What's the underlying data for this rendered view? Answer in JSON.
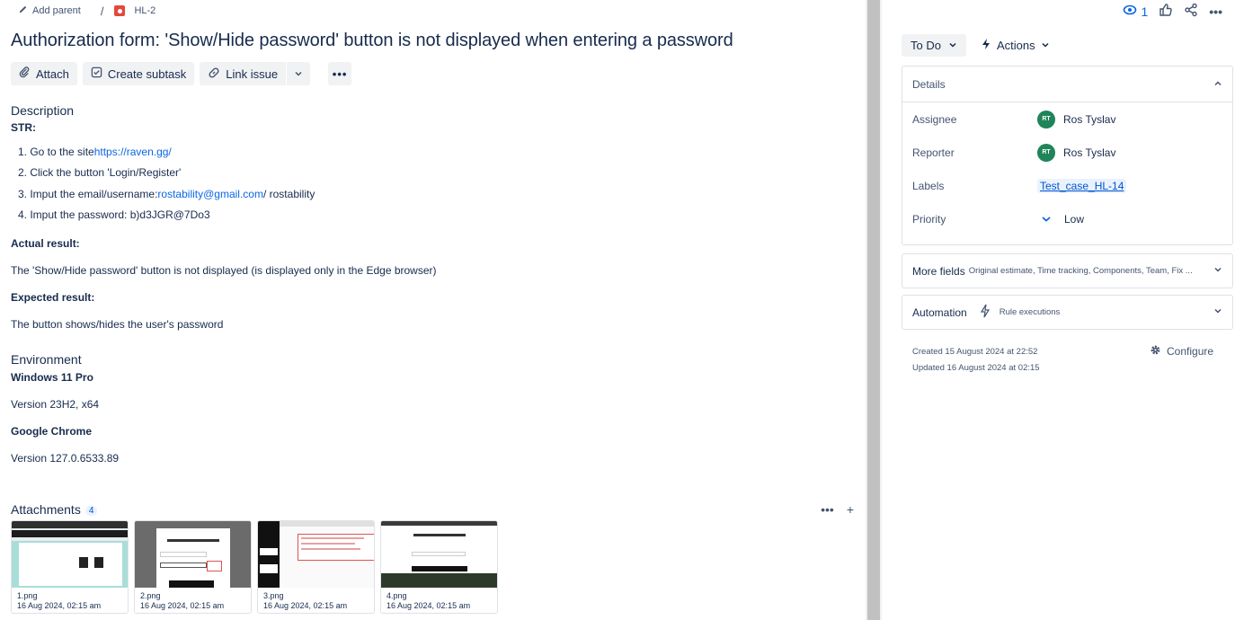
{
  "breadcrumb": {
    "add_parent": "Add parent",
    "separator": "/",
    "issue_key": "HL-2"
  },
  "issue": {
    "title": "Authorization form: 'Show/Hide password' button is not displayed when entering a password"
  },
  "toolbar": {
    "attach": "Attach",
    "create_subtask": "Create subtask",
    "link_issue": "Link issue",
    "more": "•••"
  },
  "description": {
    "heading": "Description",
    "str_label": "STR:",
    "steps": [
      {
        "text": "1. Go to the site ",
        "link": "https://raven.gg/",
        "after": ""
      },
      {
        "text": "2. Click the button 'Login/Register'",
        "link": "",
        "after": ""
      },
      {
        "text": "3. Imput the email/username: ",
        "link": "rostability@gmail.com",
        "after": " / rostability"
      },
      {
        "text": "4. Imput the password: b)d3JGR@7Do3",
        "link": "",
        "after": ""
      }
    ],
    "actual_label": "Actual result:",
    "actual_text": "The 'Show/Hide password' button is not displayed (is displayed only in the Edge browser)",
    "expected_label": "Expected result:",
    "expected_text": "The button shows/hides the user's password"
  },
  "environment": {
    "heading": "Environment",
    "os": "Windows 11 Pro",
    "os_version": "Version 23H2, x64",
    "browser": "Google Chrome",
    "browser_version": "Version 127.0.6533.89"
  },
  "attachments": {
    "heading": "Attachments",
    "count": "4",
    "items": [
      {
        "name": "1.png",
        "date": "16 Aug 2024, 02:15 am"
      },
      {
        "name": "2.png",
        "date": "16 Aug 2024, 02:15 am"
      },
      {
        "name": "3.png",
        "date": "16 Aug 2024, 02:15 am"
      },
      {
        "name": "4.png",
        "date": "16 Aug 2024, 02:15 am"
      }
    ]
  },
  "header_actions": {
    "watch_count": "1"
  },
  "status": {
    "label": "To Do",
    "actions": "Actions"
  },
  "details": {
    "heading": "Details",
    "assignee_label": "Assignee",
    "assignee_initials": "RT",
    "assignee_name": "Ros Tyslav",
    "reporter_label": "Reporter",
    "reporter_initials": "RT",
    "reporter_name": "Ros Tyslav",
    "labels_label": "Labels",
    "label_value": "Test_case_HL-14",
    "priority_label": "Priority",
    "priority_value": "Low"
  },
  "more_fields": {
    "label": "More fields",
    "hint": "Original estimate, Time tracking, Components, Team, Fix ..."
  },
  "automation": {
    "label": "Automation",
    "hint": "Rule executions"
  },
  "meta": {
    "created": "Created 15 August 2024 at 22:52",
    "updated": "Updated 16 August 2024 at 02:15",
    "configure": "Configure"
  },
  "colors": {
    "accent": "#0c66e4",
    "avatar": "#1f845a",
    "bug": "#e2483d"
  }
}
